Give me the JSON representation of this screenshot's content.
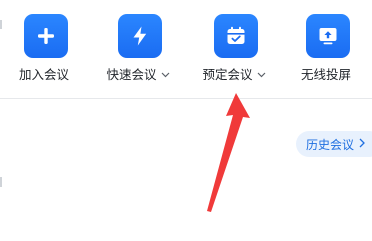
{
  "actions": [
    {
      "label": "加入会议",
      "icon": "plus-icon"
    },
    {
      "label": "快速会议",
      "icon": "lightning-icon",
      "has_dropdown": true
    },
    {
      "label": "预定会议",
      "icon": "calendar-icon",
      "has_dropdown": true
    },
    {
      "label": "无线投屏",
      "icon": "screen-cast-icon"
    }
  ],
  "history": {
    "label": "历史会议"
  },
  "colors": {
    "accent": "#1a6cf2",
    "history_bg": "#e8f1fd",
    "history_text": "#1f6fe0",
    "annotation_arrow": "#f03a3a"
  }
}
